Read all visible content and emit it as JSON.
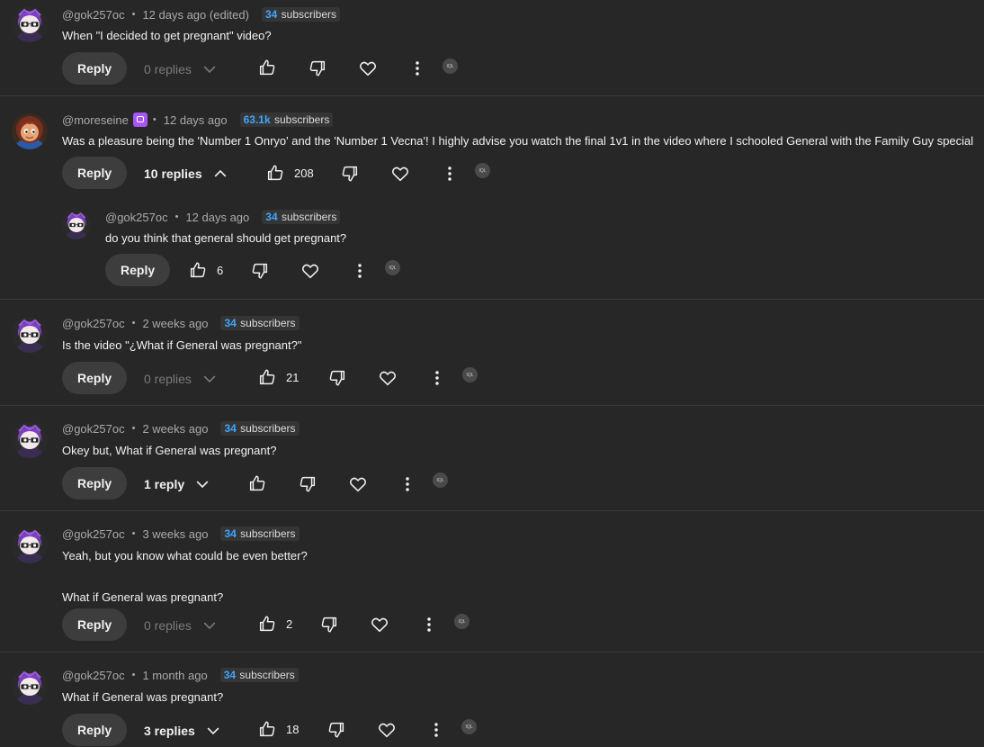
{
  "labels": {
    "reply": "Reply"
  },
  "colors": {
    "background": "#272727",
    "subscriber_count": "#3ea6ff",
    "badge": "#a855f7"
  },
  "icons": {
    "like": "thumb-up-icon",
    "dislike": "thumb-down-icon",
    "heart": "heart-icon",
    "more": "more-vert-icon",
    "mini": "extension-icon",
    "mini_label": "IQL"
  },
  "comments": [
    {
      "author": "@gok257oc",
      "time": "12 days ago (edited)",
      "subs_count": "34",
      "subs_label": "subscribers",
      "text": "When \"I decided to get pregnant\" video?",
      "replies": "0 replies",
      "likes": ""
    },
    {
      "author": "@moreseine",
      "time": "12 days ago",
      "subs_count": "63.1k",
      "subs_label": "subscribers",
      "text": "Was a pleasure being the 'Number 1 Onryo' and the 'Number 1 Vecna'! I highly advise you watch the final 1v1 in the video where I schooled General with the Family Guy special",
      "replies": "10 replies",
      "likes": "208"
    },
    {
      "author": "@gok257oc",
      "time": "12 days ago",
      "subs_count": "34",
      "subs_label": "subscribers",
      "text": "do you think that general should get pregnant?",
      "likes": "6"
    },
    {
      "author": "@gok257oc",
      "time": "2 weeks ago",
      "subs_count": "34",
      "subs_label": "subscribers",
      "text": "Is the video \"¿What if General was pregnant?\"",
      "replies": "0 replies",
      "likes": "21"
    },
    {
      "author": "@gok257oc",
      "time": "2 weeks ago",
      "subs_count": "34",
      "subs_label": "subscribers",
      "text": "Okey but, What if General was pregnant?",
      "replies": "1 reply",
      "likes": ""
    },
    {
      "author": "@gok257oc",
      "time": "3 weeks ago",
      "subs_count": "34",
      "subs_label": "subscribers",
      "text": "Yeah, but you know what could be even better?\n\nWhat if General was pregnant?",
      "replies": "0 replies",
      "likes": "2"
    },
    {
      "author": "@gok257oc",
      "time": "1 month ago",
      "subs_count": "34",
      "subs_label": "subscribers",
      "text": "What if General was pregnant?",
      "replies": "3 replies",
      "likes": "18"
    }
  ]
}
